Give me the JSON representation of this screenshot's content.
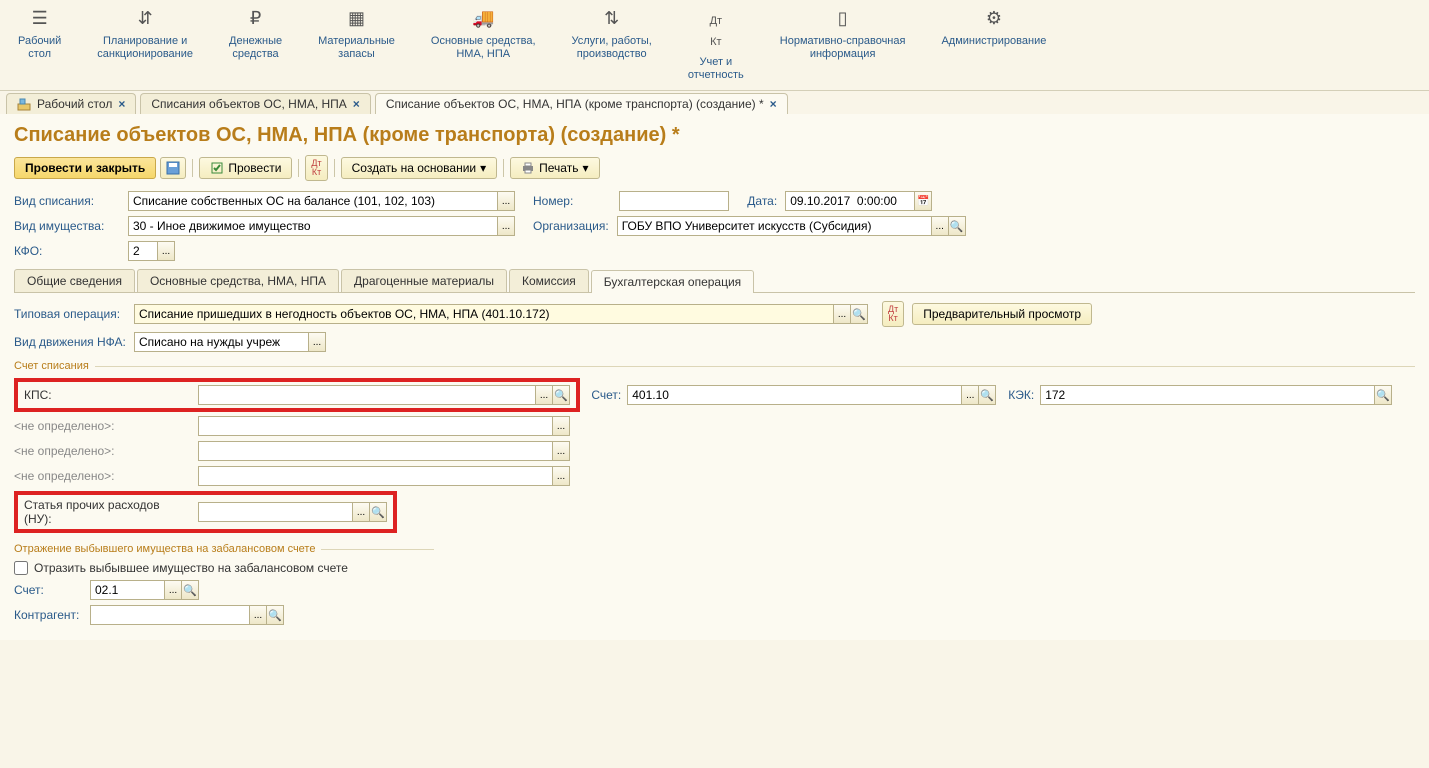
{
  "nav": [
    {
      "label": "Рабочий\nстол"
    },
    {
      "label": "Планирование и\nсанкционирование"
    },
    {
      "label": "Денежные\nсредства"
    },
    {
      "label": "Материальные\nзапасы"
    },
    {
      "label": "Основные средства,\nНМА, НПА"
    },
    {
      "label": "Услуги, работы,\nпроизводство"
    },
    {
      "label": "Учет и\nотчетность"
    },
    {
      "label": "Нормативно-справочная\nинформация"
    },
    {
      "label": "Администрирование"
    }
  ],
  "tabs": [
    {
      "label": "Рабочий стол"
    },
    {
      "label": "Списания объектов ОС, НМА, НПА"
    },
    {
      "label": "Списание объектов ОС, НМА, НПА (кроме транспорта) (создание) *"
    }
  ],
  "page_title": "Списание объектов ОС, НМА, НПА (кроме транспорта) (создание) *",
  "toolbar": {
    "post_close": "Провести и закрыть",
    "post": "Провести",
    "create_based": "Создать на основании",
    "print": "Печать"
  },
  "header": {
    "label_vid_spisaniya": "Вид списания:",
    "vid_spisaniya": "Списание собственных ОС на балансе (101, 102, 103)",
    "label_nomer": "Номер:",
    "nomer": "",
    "label_data": "Дата:",
    "data": "09.10.2017  0:00:00",
    "label_vid_im": "Вид имущества:",
    "vid_im": "30 - Иное движимое имущество",
    "label_org": "Организация:",
    "org": "ГОБУ ВПО Университет искусств (Субсидия)",
    "label_kfo": "КФО:",
    "kfo": "2"
  },
  "inner_tabs": [
    "Общие сведения",
    "Основные средства, НМА, НПА",
    "Драгоценные материалы",
    "Комиссия",
    "Бухгалтерская операция"
  ],
  "op": {
    "label_typ": "Типовая операция:",
    "typ_value": "Списание пришедших в негодность объектов ОС, НМА, НПА (401.10.172)",
    "btn_preview": "Предварительный просмотр",
    "label_vid_dv": "Вид движения НФА:",
    "vid_dv_value": "Списано на нужды учреж"
  },
  "schet_spisaniya": {
    "legend": "Счет списания",
    "label_kps": "КПС:",
    "kps": "",
    "label_schet": "Счет:",
    "schet": "401.10",
    "label_kek": "КЭК:",
    "kek": "172",
    "undef": "<не определено>:",
    "label_statya": "Статья прочих расходов (НУ):",
    "statya": ""
  },
  "zabalans": {
    "legend": "Отражение выбывшего имущества на забалансовом счете",
    "checkbox_label": "Отразить выбывшее имущество на забалансовом счете",
    "label_schet": "Счет:",
    "schet": "02.1",
    "label_kontragent": "Контрагент:",
    "kontragent": ""
  }
}
